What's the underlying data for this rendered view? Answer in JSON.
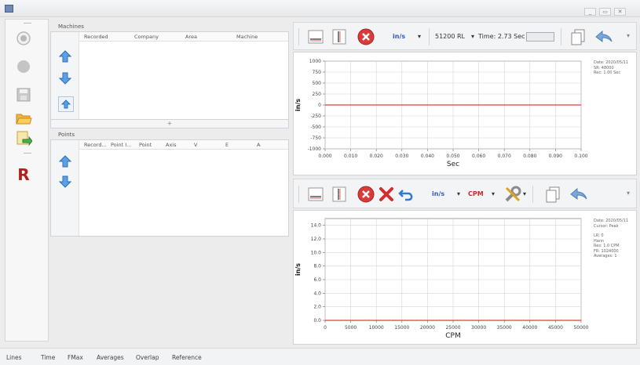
{
  "window": {
    "minimize_label": "_",
    "restore_label": "▭",
    "close_label": "✕"
  },
  "leftbar": {
    "report_label": "R"
  },
  "machines": {
    "title": "Machines",
    "columns": [
      "Recorded",
      "Company",
      "Area",
      "Machine"
    ],
    "add_label": "+"
  },
  "points": {
    "title": "Points",
    "columns": [
      "Record...",
      "Point I...",
      "Point",
      "Axis",
      "V",
      "E",
      "A"
    ]
  },
  "top_toolbar": {
    "units_label": "in/s",
    "units_dropdown": "▾",
    "lines_label": "51200 RL",
    "lines_dropdown": "▾",
    "time_label": "Time: 2.73 Sec",
    "more_label": "▾"
  },
  "bottom_toolbar": {
    "units_label": "in/s",
    "units_dropdown": "▾",
    "xunits_label": "CPM",
    "xunits_dropdown": "▾",
    "tools_dropdown": "▾",
    "more_label": "▾"
  },
  "waveform": {
    "info_lines": [
      "Date: 2020/05/11",
      "SR: 48000",
      "Rec: 1.00 Sec"
    ]
  },
  "spectrum": {
    "info_lines": [
      "Date: 2020/05/11",
      "Cursor: Peak",
      "",
      "LR: 0",
      "Hann",
      "Res: 1.0 CPM",
      "FR: 1024000",
      "Averages: 1"
    ]
  },
  "chart_data": [
    {
      "type": "line",
      "xlabel": "Sec",
      "ylabel": "in/s",
      "xlim": [
        0,
        0.1
      ],
      "ylim": [
        -1000,
        1000
      ],
      "xticks": [
        "0.000",
        "0.010",
        "0.020",
        "0.030",
        "0.040",
        "0.050",
        "0.060",
        "0.070",
        "0.080",
        "0.090",
        "0.100"
      ],
      "yticks": [
        "1000",
        "750",
        "500",
        "250",
        "0",
        "-250",
        "-500",
        "-750",
        "-1000"
      ],
      "series": [
        {
          "x": [
            0,
            0.1
          ],
          "y": [
            0,
            0
          ],
          "color": "#e03c3c"
        }
      ],
      "grid": true
    },
    {
      "type": "line",
      "xlabel": "CPM",
      "ylabel": "in/s",
      "xlim": [
        0,
        50000
      ],
      "ylim": [
        0,
        15
      ],
      "xticks": [
        "0",
        "5000",
        "10000",
        "15000",
        "20000",
        "25000",
        "30000",
        "35000",
        "40000",
        "45000",
        "50000"
      ],
      "yticks": [
        "14.0",
        "12.0",
        "10.0",
        "8.0",
        "6.0",
        "4.0",
        "2.0",
        "0.0"
      ],
      "series": [
        {
          "x": [
            0,
            50000
          ],
          "y": [
            0,
            0
          ],
          "color": "#e03c3c"
        }
      ],
      "grid": true
    }
  ],
  "statusbar": {
    "items": [
      "Lines",
      "Time",
      "FMax",
      "Averages",
      "Overlap",
      "Reference"
    ]
  }
}
